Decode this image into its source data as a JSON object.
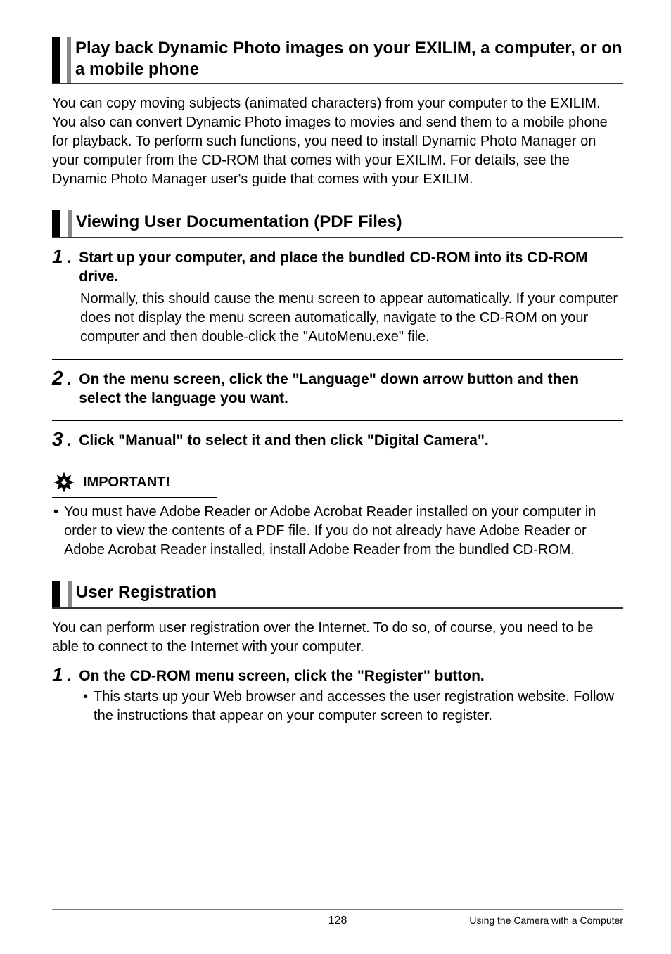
{
  "section1": {
    "title": "Play back Dynamic Photo images on your EXILIM, a computer, or on a mobile phone",
    "body": "You can copy moving subjects (animated characters) from your computer to the EXILIM. You also can convert Dynamic Photo images to movies and send them to a mobile phone for playback. To perform such functions, you need to install Dynamic Photo Manager on your computer from the CD-ROM that comes with your EXILIM. For details, see the Dynamic Photo Manager user's guide that comes with your EXILIM."
  },
  "section2": {
    "title": "Viewing User Documentation (PDF Files)",
    "steps": [
      {
        "num": "1",
        "title": "Start up your computer, and place the bundled CD-ROM into its CD-ROM drive.",
        "body": "Normally, this should cause the menu screen to appear automatically. If your computer does not display the menu screen automatically, navigate to the CD-ROM on your computer and then double-click the \"AutoMenu.exe\" file."
      },
      {
        "num": "2",
        "title": "On the menu screen, click the \"Language\" down arrow button and then select the language you want.",
        "body": ""
      },
      {
        "num": "3",
        "title": "Click \"Manual\" to select it and then click \"Digital Camera\".",
        "body": ""
      }
    ],
    "important_label": "IMPORTANT!",
    "important_body": "You must have Adobe Reader or Adobe Acrobat Reader installed on your computer in order to view the contents of a PDF file. If you do not already have Adobe Reader or Adobe Acrobat Reader installed, install Adobe Reader from the bundled CD-ROM."
  },
  "section3": {
    "title": "User Registration",
    "body": "You can perform user registration over the Internet. To do so, of course, you need to be able to connect to the Internet with your computer.",
    "steps": [
      {
        "num": "1",
        "title": "On the CD-ROM menu screen, click the \"Register\" button.",
        "sub": "This starts up your Web browser and accesses the user registration website. Follow the instructions that appear on your computer screen to register."
      }
    ]
  },
  "footer": {
    "page": "128",
    "right": "Using the Camera with a Computer"
  }
}
